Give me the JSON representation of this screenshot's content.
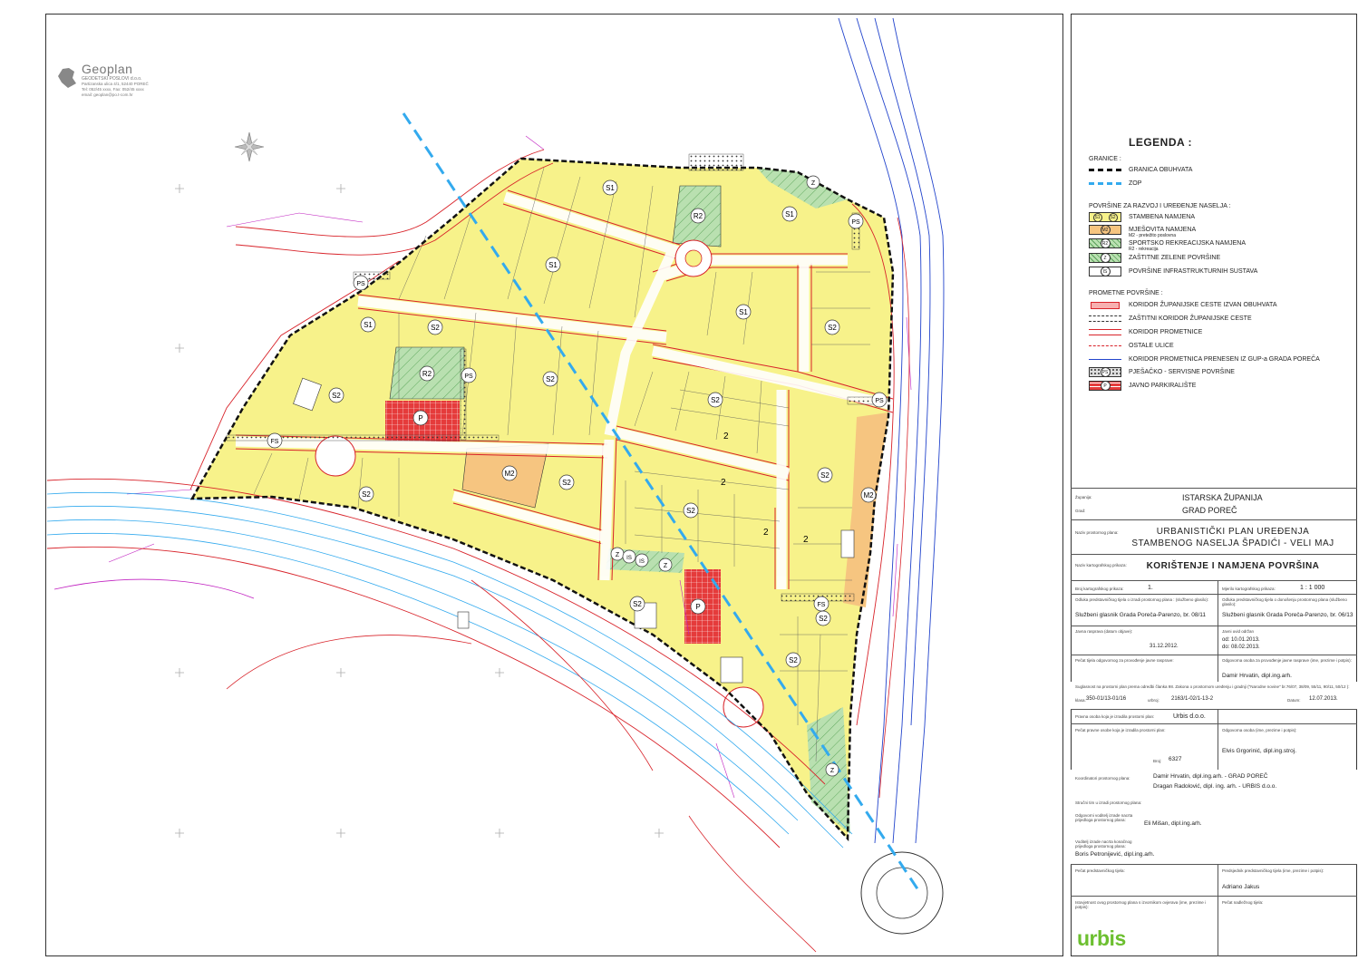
{
  "logo": {
    "name": "Geoplan",
    "line1": "GEODETSKI POSLOVI d.o.o.",
    "line2": "Partizanska ulica 4/1, 52440 POREČ",
    "line3": "Tel: 052/45 xxxx, Fax: 052/45 xxxx",
    "line4": "email: geoplan@po.t-com.hr"
  },
  "zones": [
    {
      "label": "S1"
    },
    {
      "label": "S1"
    },
    {
      "label": "S1"
    },
    {
      "label": "S1"
    },
    {
      "label": "S1"
    },
    {
      "label": "S2"
    },
    {
      "label": "S2"
    },
    {
      "label": "S2"
    },
    {
      "label": "S2"
    },
    {
      "label": "S2"
    },
    {
      "label": "S2"
    },
    {
      "label": "S2"
    },
    {
      "label": "S2"
    },
    {
      "label": "S2"
    },
    {
      "label": "S2"
    },
    {
      "label": "S2"
    },
    {
      "label": "S2"
    },
    {
      "label": "R2"
    },
    {
      "label": "R2"
    },
    {
      "label": "M2"
    },
    {
      "label": "M2"
    },
    {
      "label": "Z"
    },
    {
      "label": "Z"
    },
    {
      "label": "Z"
    },
    {
      "label": "Z"
    },
    {
      "label": "IS"
    },
    {
      "label": "IS"
    },
    {
      "label": "PS"
    },
    {
      "label": "PS"
    },
    {
      "label": "PS"
    },
    {
      "label": "PS"
    },
    {
      "label": "FS"
    },
    {
      "label": "FS"
    },
    {
      "label": "P"
    },
    {
      "label": "P"
    },
    {
      "label": "2"
    },
    {
      "label": "2"
    },
    {
      "label": "2"
    },
    {
      "label": "2"
    }
  ],
  "legend": {
    "title": "LEGENDA :",
    "granice_header": "GRANICE :",
    "granica": "GRANICA OBUHVATA",
    "zop": "ZOP",
    "povrsine_header": "POVRŠINE ZA RAZVOJ I UREĐENJE NASELJA :",
    "stambena_syms": [
      "S1",
      "S2"
    ],
    "stambena": "STAMBENA NAMJENA",
    "mjesovita_sym": "M2",
    "mjesovita": "MJEŠOVITA NAMJENA",
    "mjesovita_sub": "M2 - pretežito poslovna",
    "sportska_sym": "R2",
    "sportska": "SPORTSKO REKREACIJSKA NAMJENA",
    "sportska_sub": "R2 - rekreacija",
    "zastitne_sym": "Z",
    "zastitne": "ZAŠTITNE ZELENE POVRŠINE",
    "infra_sym": "IS",
    "infra": "POVRŠINE INFRASTRUKTURNIH SUSTAVA",
    "prometne_header": "PROMETNE POVRŠINE :",
    "koridor_zup": "KORIDOR ŽUPANIJSKE CESTE IZVAN OBUHVATA",
    "zastitni_koridor": "ZAŠTITNI KORIDOR ŽUPANIJSKE CESTE",
    "koridor_prom": "KORIDOR PROMETNICE",
    "ostale": "OSTALE ULICE",
    "koridor_gup": "KORIDOR PROMETNICA PRENESEN IZ GUP-a GRADA POREČA",
    "pjesacko_sym": "PS",
    "pjesacko": "PJEŠAČKO - SERVISNE POVRŠINE",
    "parking_sym": "P",
    "parking": "JAVNO PARKIRALIŠTE"
  },
  "title_block": {
    "zupanija_lab": "Županija:",
    "zupanija": "ISTARSKA ŽUPANIJA",
    "grad_lab": "Grad:",
    "grad": "GRAD POREČ",
    "naziv_lab": "Naziv prostornog plana:",
    "naziv1": "URBANISTIČKI PLAN UREĐENJA",
    "naziv2": "STAMBENOG NASELJA ŠPADIĆI - VELI MAJ",
    "karta_lab": "Naziv kartografskog prikaza:",
    "karta": "KORIŠTENJE I NAMJENA POVRŠINA",
    "broj_lab": "Broj kartografskog prikaza:",
    "broj": "1.",
    "mjerilo_lab": "Mjerilo kartografskog prikaza:",
    "mjerilo": "1 : 1 000",
    "odluka_lab": "Odluka predstavničkog tijela o izradi prostornog plana : (službeno glasilo):",
    "odluka": "Službeni glasnik Grada Poreča-Parenzo, br. 08/11",
    "odluka2_lab": "Odluka predstavničkog tijela o donošenju prostornog plana (službeno glasilo):",
    "odluka2": "Službeni glasnik Grada Poreča-Parenzo, br. 06/13",
    "rasprava_lab": "Javna rasprava (datum objave):",
    "rasprava": "31.12.2012.",
    "uvid_lab": "Javni uvid održan",
    "uvid1": "od: 10.01.2013.",
    "uvid2": "do: 08.02.2013.",
    "pecat_lab": "Pečat tijela odgovornog za provođenje javne rasprave:",
    "odgovorna_lab": "Odgovorna osoba za provođenje javne rasprave (ime, prezime i potpis):",
    "odgovorna": "Damir Hrvatin, dipl.ing.arh.",
    "suglasnost_lab": "Suglasnost na prostorni plan prema odredbi članka 98. Zakona o prostornom uređenju i gradnji (\"Narodne novine\" br.76/07, 38/09, 55/11, 90/11, 50/12 ):",
    "klasa_lab": "klasa:",
    "klasa": "350-01/13-01/16",
    "urbroj_lab": "urbroj:",
    "urbroj": "2163/1-02/1-13-2",
    "datum_lab": "Datum:",
    "datum": "12.07.2013.",
    "pravna_lab": "Pravna osoba koja je izradila prostorni plan:",
    "pravna": "Urbis d.o.o.",
    "pecat2_lab": "Pečat pravne osobe koja je izradila prostorni plan:",
    "odg2_lab": "Odgovorna osoba (ime, prezime i potpis):",
    "odg2": "Elvis Grgorinić, dipl.ing.stroj.",
    "broj2_lab": "Broj:",
    "broj2": "6327",
    "koord_lab": "Koordinatori prostornog plana:",
    "koord1": "Damir Hrvatin, dipl.ing.arh. - GRAD POREČ",
    "koord2": "Dragan Radolović, dipl. ing. arh. - URBIS d.o.o.",
    "strucni_lab": "Stručni tim u izradi prostornog plana:",
    "odg3_lab": "Odgovorni voditelj izrade nacrta prijedloga prostornog plana:",
    "odg3": "Eli Mišan, dipl.ing.arh.",
    "vod_lab": "Voditelj izrade nacrta konačnog prijedloga prostornog plana:",
    "vod": "Boris Petronijević, dipl.ing.arh.",
    "pecat3_lab": "Pečat predstavničkog tijela:",
    "pred_lab": "Predsjednik predstavničkog tijela (ime, prezime i potpis):",
    "pred": "Adriano Jakus",
    "istov_lab": "Istovjetnost ovog prostornog plana s izvornikom ovjerava (ime, prezime i potpis):",
    "pecat4_lab": "Pečat nadležnog tijela:",
    "brand": "urbis"
  },
  "colors": {
    "yellow": "#f7f28a",
    "orange": "#f6c580",
    "green": "#b9e0b0",
    "red_zone": "#e53b3b",
    "red_line": "#d8232a",
    "magenta": "#c020c0",
    "cyan": "#33aaee",
    "blue": "#2244cc",
    "brand": "#6cbf2f"
  }
}
